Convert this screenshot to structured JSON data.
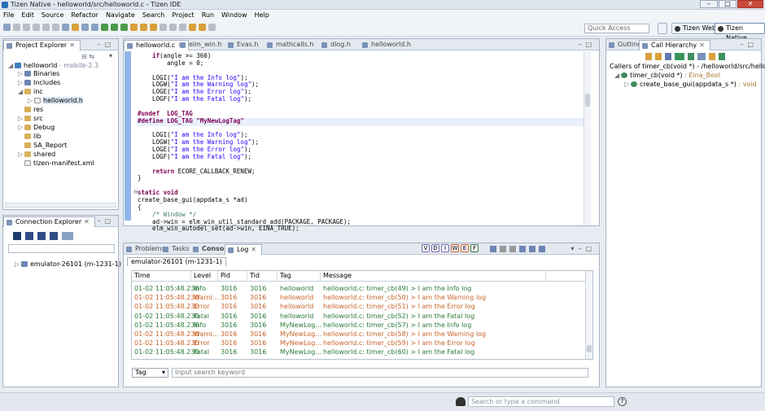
{
  "window": {
    "title": "Tizen Native - helloworld/src/helloworld.c - Tizen IDE"
  },
  "menu": [
    "File",
    "Edit",
    "Source",
    "Refactor",
    "Navigate",
    "Search",
    "Project",
    "Run",
    "Window",
    "Help"
  ],
  "toolbar": {
    "quick_access_placeholder": "Quick Access",
    "perspectives": [
      "Tizen Web",
      "Tizen Native"
    ]
  },
  "project_explorer": {
    "tab": "Project Explorer",
    "project": "helloworld",
    "project_suffix": "- mobile-2.3",
    "items": [
      "Binaries",
      "Includes",
      "inc",
      "helloworld.h",
      "res",
      "src",
      "Debug",
      "lib",
      "SA_Report",
      "shared",
      "tizen-manifest.xml"
    ]
  },
  "connection_explorer": {
    "tab": "Connection Explorer",
    "device": "emulator-26101 (m-1231-1)"
  },
  "editor": {
    "tabs": [
      "helloworld.c",
      "elm_win.h",
      "Evas.h",
      "mathcalls.h",
      "dlog.h",
      "helloworld.h"
    ],
    "lines": [
      "    if(angle >= 360)",
      "        angle = 0;",
      "",
      "    LOGI(\"I am the Info log\");",
      "    LOGW(\"I am the Warning log\");",
      "    LOGE(\"I am the Error log\");",
      "    LOGF(\"I am the Fatal log\");",
      "",
      "#undef  LOG_TAG",
      "#define LOG_TAG \"MyNewLogTag\"",
      "",
      "    LOGI(\"I am the Info log\");",
      "    LOGW(\"I am the Warning log\");",
      "    LOGE(\"I am the Error log\");",
      "    LOGF(\"I am the Fatal log\");",
      "",
      "    return ECORE_CALLBACK_RENEW;",
      "}",
      "",
      "static void",
      "create_base_gui(appdata_s *ad)",
      "{",
      "    /* Window */",
      "    ad->win = elm_win_util_standard_add(PACKAGE, PACKAGE);",
      "    elm_win_autodel_set(ad->win, EINA_TRUE);"
    ]
  },
  "outline": {
    "tabs": [
      "Outline",
      "Call Hierarchy"
    ],
    "callers_title": "Callers of timer_cb(void *) - /helloworld/src/helloworld.c -",
    "node1": "timer_cb(void *)",
    "node1_type": ": Eina_Bool",
    "node2": "create_base_gui(appdata_s *)",
    "node2_type": ": void"
  },
  "bottom": {
    "tabs": [
      "Problems",
      "Tasks",
      "Console",
      "Log"
    ],
    "device_tab": "emulator-26101 (m-1231-1)",
    "level_buttons": [
      "V",
      "D",
      "I",
      "W",
      "E",
      "F"
    ],
    "columns": [
      "Time",
      "Level",
      "Pid",
      "Tid",
      "Tag",
      "Message"
    ],
    "rows": [
      {
        "time": "01-02 11:05:48.230",
        "level": "Info",
        "pid": "3016",
        "tid": "3016",
        "tag": "helloworld",
        "msg": "helloworld.c: timer_cb(49) > I am the Info log",
        "kind": "info"
      },
      {
        "time": "01-02 11:05:48.230",
        "level": "Warni...",
        "pid": "3016",
        "tid": "3016",
        "tag": "helloworld",
        "msg": "helloworld.c: timer_cb(50) > I am the Warning log",
        "kind": "warn"
      },
      {
        "time": "01-02 11:05:48.230",
        "level": "Error",
        "pid": "3016",
        "tid": "3016",
        "tag": "helloworld",
        "msg": "helloworld.c: timer_cb(51) > I am the Error log",
        "kind": "error"
      },
      {
        "time": "01-02 11:05:48.230",
        "level": "Fatal",
        "pid": "3016",
        "tid": "3016",
        "tag": "helloworld",
        "msg": "helloworld.c: timer_cb(52) > I am the Fatal log",
        "kind": "fatal"
      },
      {
        "time": "01-02 11:05:48.230",
        "level": "Info",
        "pid": "3016",
        "tid": "3016",
        "tag": "MyNewLog...",
        "msg": "helloworld.c: timer_cb(57) > I am the Info log",
        "kind": "info"
      },
      {
        "time": "01-02 11:05:48.230",
        "level": "Warni...",
        "pid": "3016",
        "tid": "3016",
        "tag": "MyNewLog...",
        "msg": "helloworld.c: timer_cb(58) > I am the Warning log",
        "kind": "warn"
      },
      {
        "time": "01-02 11:05:48.230",
        "level": "Error",
        "pid": "3016",
        "tid": "3016",
        "tag": "MyNewLog...",
        "msg": "helloworld.c: timer_cb(59) > I am the Error log",
        "kind": "error"
      },
      {
        "time": "01-02 11:05:48.230",
        "level": "Fatal",
        "pid": "3016",
        "tid": "3016",
        "tag": "MyNewLog...",
        "msg": "helloworld.c: timer_cb(60) > I am the Fatal log",
        "kind": "fatal"
      }
    ],
    "filter_select": "Tag",
    "search_placeholder": "Input search keyword"
  },
  "statusbar": {
    "search_placeholder": "Search or type a command"
  },
  "colors": {
    "info": "#2a7a3a",
    "warn": "#c9642a",
    "keyword": "#7f0055",
    "string": "#2a00ff",
    "comment": "#3f7f5f"
  }
}
